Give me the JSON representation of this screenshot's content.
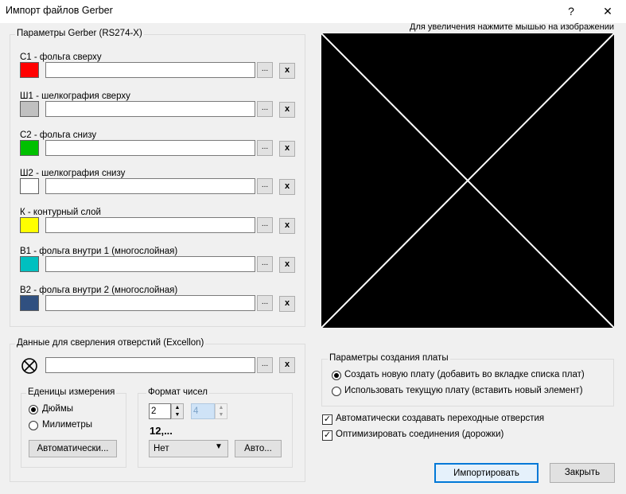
{
  "window": {
    "title": "Импорт файлов Gerber",
    "help_glyph": "?",
    "close_glyph": "✕"
  },
  "gerber": {
    "group_label": "Параметры Gerber (RS274-X)",
    "browse_label": "...",
    "clear_label": "x",
    "layers": [
      {
        "label": "С1 - фольга сверху",
        "color": "#ff0000",
        "value": ""
      },
      {
        "label": "Ш1 - шелкография сверху",
        "color": "#c0c0c0",
        "value": ""
      },
      {
        "label": "С2 - фольга снизу",
        "color": "#00c000",
        "value": ""
      },
      {
        "label": "Ш2 - шелкография снизу",
        "color": "#ffffff",
        "value": ""
      },
      {
        "label": "К - контурный слой",
        "color": "#ffff00",
        "value": ""
      },
      {
        "label": "В1 - фольга внутри 1 (многослойная)",
        "color": "#00c0c0",
        "value": ""
      },
      {
        "label": "В2 - фольга внутри 2 (многослойная)",
        "color": "#305080",
        "value": ""
      }
    ]
  },
  "excellon": {
    "group_label": "Данные для сверления отверстий (Excellon)",
    "value": "",
    "units": {
      "label": "Еденицы измерения",
      "inches": "Дюймы",
      "millimeters": "Милиметры",
      "auto_button": "Автоматически..."
    },
    "format": {
      "label": "Формат чисел",
      "int_digits": "2",
      "dec_digits": "4",
      "sample": "12,...",
      "zeros_value": "Нет",
      "auto_button": "Авто..."
    }
  },
  "preview": {
    "hint": "Для увеличения нажмите мышью на изображении"
  },
  "board": {
    "group_label": "Параметры создания платы",
    "create_new": "Создать новую плату (добавить во вкладке списка плат)",
    "use_current": "Использовать текущую плату (вставить новый элемент)"
  },
  "options": {
    "auto_vias": "Автоматически создавать переходные отверстия",
    "optimize": "Оптимизировать соединения (дорожки)"
  },
  "buttons": {
    "import": "Импортировать",
    "close": "Закрыть"
  }
}
